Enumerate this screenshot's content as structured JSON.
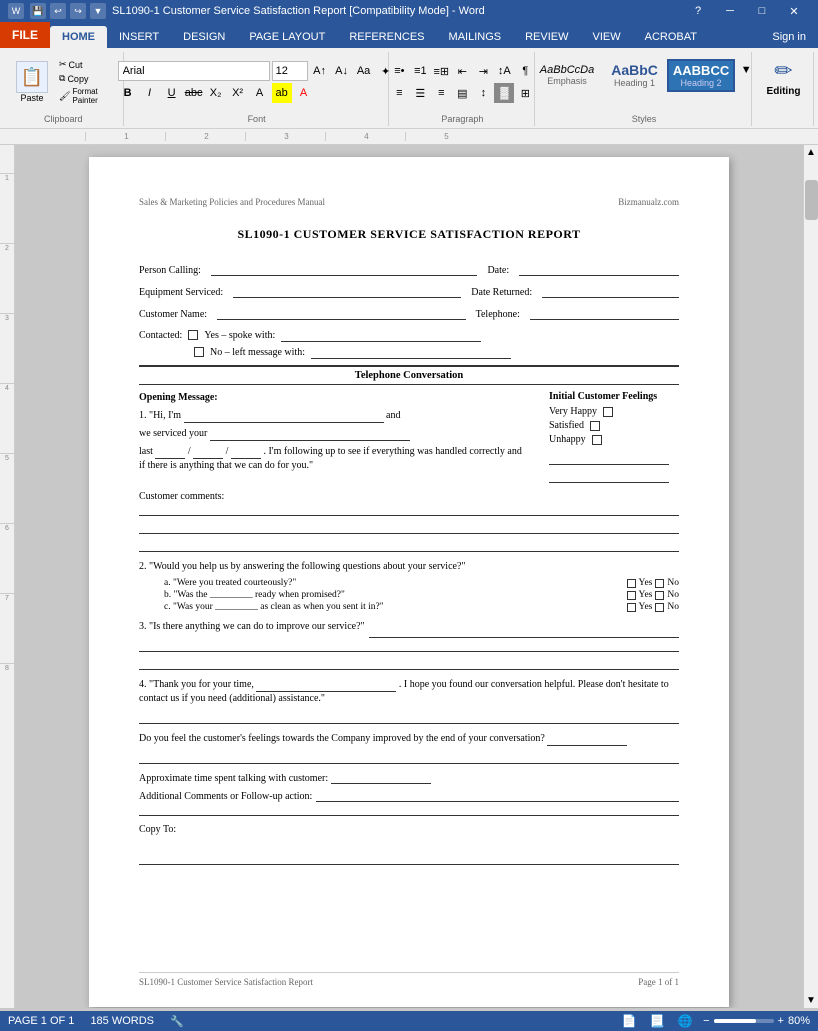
{
  "titleBar": {
    "title": "SL1090-1 Customer Service Satisfaction Report [Compatibility Mode] - Word",
    "helpIcon": "?",
    "minIcon": "─",
    "maxIcon": "□",
    "closeIcon": "✕"
  },
  "ribbon": {
    "tabs": [
      "FILE",
      "HOME",
      "INSERT",
      "DESIGN",
      "PAGE LAYOUT",
      "REFERENCES",
      "MAILINGS",
      "REVIEW",
      "VIEW",
      "ACROBAT"
    ],
    "activeTab": "HOME",
    "signIn": "Sign in",
    "clipboard": {
      "label": "Clipboard",
      "pasteLabel": "Paste",
      "cutLabel": "Cut",
      "copyLabel": "Copy",
      "formatPainterLabel": "Format Painter"
    },
    "font": {
      "label": "Font",
      "name": "Arial",
      "size": "12",
      "boldLabel": "B",
      "italicLabel": "I",
      "underlineLabel": "U"
    },
    "paragraph": {
      "label": "Paragraph"
    },
    "styles": {
      "label": "Styles",
      "items": [
        {
          "name": "Emphasis",
          "label": "Emphasis",
          "style": "emphasis"
        },
        {
          "name": "Heading 1",
          "label": "Heading 1",
          "style": "h1"
        },
        {
          "name": "Heading 2",
          "label": "Heading 2",
          "style": "h2"
        }
      ]
    },
    "editing": {
      "label": "Editing"
    }
  },
  "document": {
    "headerLeft": "Sales & Marketing Policies and Procedures Manual",
    "headerRight": "Bizmanualz.com",
    "title": "SL1090-1 CUSTOMER SERVICE SATISFACTION REPORT",
    "fields": {
      "personCallingLabel": "Person Calling:",
      "dateLabel": "Date:",
      "equipmentServicedLabel": "Equipment Serviced:",
      "dateReturnedLabel": "Date Returned:",
      "customerNameLabel": "Customer Name:",
      "telephoneLabel": "Telephone:",
      "contactedLabel": "Contacted:",
      "yesSpokeLabel": "Yes – spoke with:",
      "noMessageLabel": "No – left message with:"
    },
    "sectionTitle": "Telephone Conversation",
    "openingMessage": {
      "label": "Opening Message:",
      "text1": "1. \"Hi, I'm",
      "andText": "and",
      "text2": "we serviced your",
      "lastText": "last",
      "slashText": "/",
      "slashText2": "/",
      "followUpText": ". I'm following up to see if everything was handled correctly and if there is anything that we can do for you.\""
    },
    "initialFeelings": {
      "label": "Initial Customer Feelings",
      "veryHappy": "Very Happy",
      "satisfied": "Satisfied",
      "unhappy": "Unhappy"
    },
    "customerComments": "Customer comments:",
    "question2": {
      "text": "2. \"Would you help us by answering the following questions about your service?\"",
      "a": "a. \"Were you treated courteously?\"",
      "b": "b. \"Was the _________ ready when promised?\"",
      "c": "c. \"Was your _________ as clean as when you sent it in?\""
    },
    "question3": {
      "text": "3. \"Is there anything we can do to improve our service?\""
    },
    "question4": {
      "text1": "4. \"Thank you for your time,",
      "text2": ". I hope you found our conversation helpful. Please don't hesitate to contact us if you need (additional) assistance.\""
    },
    "improvedQuestion": "Do you feel the customer's feelings towards the Company improved by the end of your conversation?",
    "approxTime": "Approximate time spent talking with customer:",
    "additionalComments": "Additional Comments or Follow-up action:",
    "copyTo": "Copy To:",
    "footerLeft": "SL1090-1 Customer Service Satisfaction Report",
    "footerRight": "Page 1 of 1"
  },
  "statusBar": {
    "page": "PAGE 1 OF 1",
    "words": "185 WORDS",
    "zoom": "80%"
  }
}
